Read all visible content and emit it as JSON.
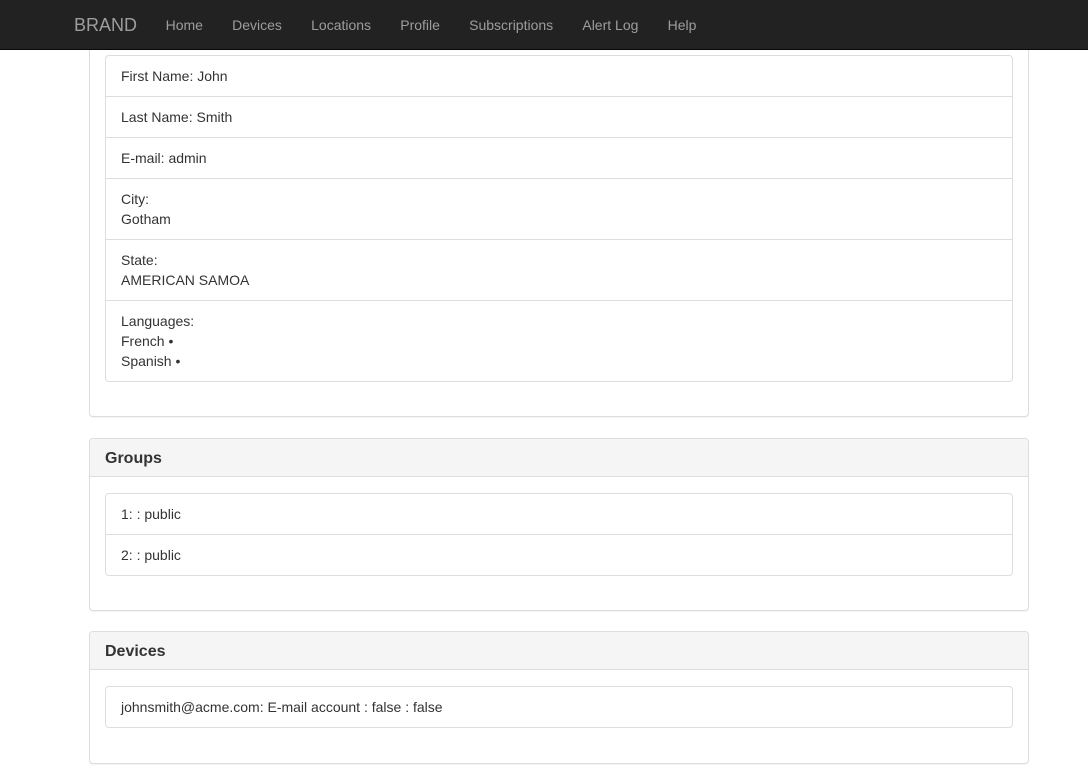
{
  "navbar": {
    "brand": "BRAND",
    "items": [
      "Home",
      "Devices",
      "Locations",
      "Profile",
      "Subscriptions",
      "Alert Log",
      "Help"
    ]
  },
  "profile": {
    "first_name": "First Name: John",
    "last_name": "Last Name: Smith",
    "email": "E-mail: admin",
    "city_label": "City:",
    "city_value": "Gotham",
    "state_label": "State:",
    "state_value": "AMERICAN SAMOA",
    "languages_label": "Languages:",
    "languages": [
      "French •",
      "Spanish •"
    ]
  },
  "groups": {
    "title": "Groups",
    "items": [
      "1: : public",
      "2: : public"
    ]
  },
  "devices": {
    "title": "Devices",
    "items": [
      "johnsmith@acme.com: E-mail account : false : false"
    ]
  }
}
